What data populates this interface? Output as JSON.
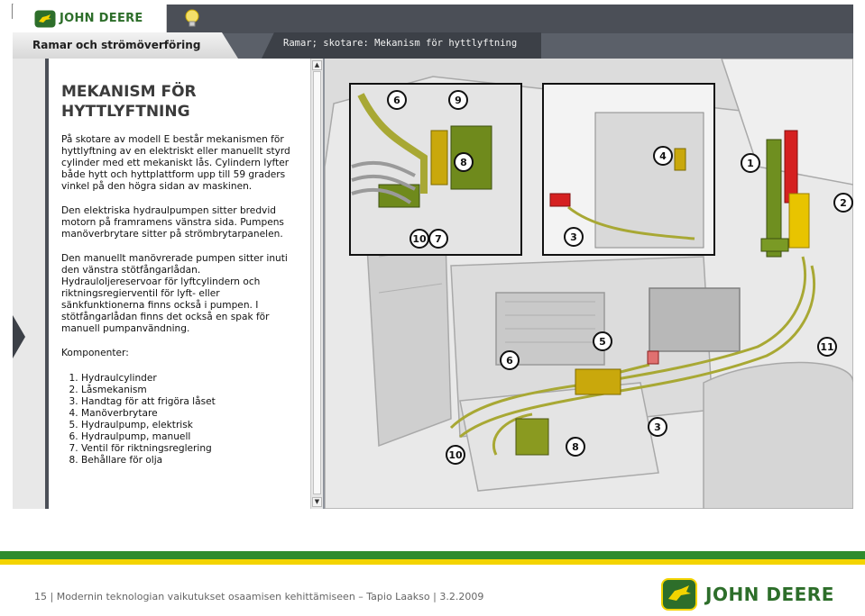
{
  "header": {
    "brand": "JOHN DEERE",
    "tab_section": "Ramar och strömöverföring",
    "tab_breadcrumb": "Ramar; skotare: Mekanism för hyttlyftning"
  },
  "content": {
    "title": "MEKANISM FÖR HYTTLYFTNING",
    "paragraphs": [
      "På skotare av modell E består mekanismen för hyttlyftning av en elektriskt eller manuellt styrd cylinder med ett mekaniskt lås. Cylindern lyfter både hytt och hyttplattform upp till 59 graders vinkel på den högra sidan av maskinen.",
      "Den elektriska hydraulpumpen sitter bredvid motorn på framramens vänstra sida. Pumpens manöverbrytare sitter på strömbrytarpanelen.",
      "Den manuellt manövrerade pumpen sitter inuti den vänstra stötfångarlådan. Hydrauloljereservoar för lyftcylindern och riktningsregierventil för lyft- eller sänkfunktionerna finns också i pumpen. I stötfångarlådan finns det också en spak för manuell pumpanvändning."
    ],
    "components_heading": "Komponenter:",
    "components": [
      "Hydraulcylinder",
      "Låsmekanism",
      "Handtag för att frigöra låset",
      "Manöverbrytare",
      "Hydraulpump, elektrisk",
      "Hydraulpump, manuell",
      "Ventil för riktningsreglering",
      "Behållare för olja"
    ]
  },
  "figure": {
    "callouts": [
      "1",
      "2",
      "3",
      "3",
      "4",
      "5",
      "6",
      "6",
      "7",
      "8",
      "8",
      "9",
      "10",
      "10",
      "11"
    ]
  },
  "footer": {
    "page": "15",
    "text": "Modernin teknologian vaikutukset osaamisen kehittämiseen – Tapio Laakso",
    "date": "3.2.2009",
    "brand": "JOHN DEERE"
  },
  "colors": {
    "brand_green": "#2d6e2a",
    "brand_yellow": "#f3d400",
    "toolbar": "#4b4f57"
  },
  "icons": [
    "cursor-icon",
    "deere-logo-icon",
    "lightbulb-icon",
    "nav-arrow-icon",
    "scroll-up-icon",
    "scroll-down-icon"
  ]
}
